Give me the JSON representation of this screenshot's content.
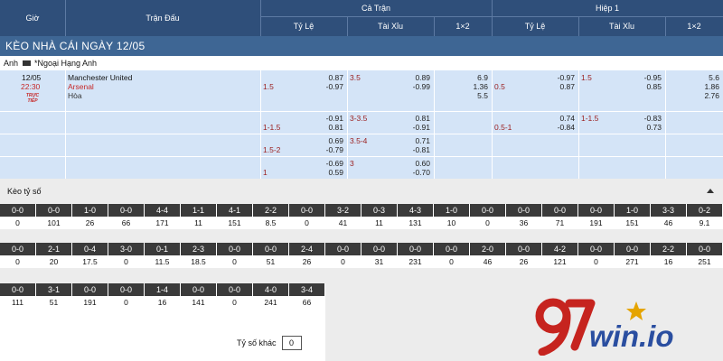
{
  "header": {
    "time": "Giờ",
    "match": "Trận Đấu",
    "full_time": "Cả Trận",
    "first_half": "Hiệp 1",
    "handicap": "Tỷ Lệ",
    "over_under": "Tài Xỉu",
    "one_x_two": "1×2"
  },
  "title": "KÈO NHÀ CÁI NGÀY 12/05",
  "league": {
    "country": "Anh",
    "name": "*Ngoại Hạng Anh"
  },
  "match": {
    "date": "12/05",
    "time": "22:30",
    "live": "TRỰC TIẾP",
    "home": "Manchester United",
    "away": "Arsenal",
    "draw": "Hòa"
  },
  "odds_rows": [
    {
      "ft_hdp_line": "1.5",
      "ft_hdp_home": "0.87",
      "ft_hdp_away": "-0.97",
      "ft_ou_line": "3.5",
      "ft_ou_over": "0.89",
      "ft_ou_under": "-0.99",
      "ft_1x2": [
        "6.9",
        "1.36",
        "5.5"
      ],
      "h1_hdp_line": "0.5",
      "h1_hdp_home": "-0.97",
      "h1_hdp_away": "0.87",
      "h1_ou_line": "1.5",
      "h1_ou_over": "-0.95",
      "h1_ou_under": "0.85",
      "h1_1x2": [
        "5.6",
        "1.86",
        "2.76"
      ]
    },
    {
      "ft_hdp_line": "1-1.5",
      "ft_hdp_home": "-0.91",
      "ft_hdp_away": "0.81",
      "ft_ou_line": "3-3.5",
      "ft_ou_over": "0.81",
      "ft_ou_under": "-0.91",
      "h1_hdp_line": "0.5-1",
      "h1_hdp_home": "0.74",
      "h1_hdp_away": "-0.84",
      "h1_ou_line": "1-1.5",
      "h1_ou_over": "-0.83",
      "h1_ou_under": "0.73"
    },
    {
      "ft_hdp_line": "1.5-2",
      "ft_hdp_home": "0.69",
      "ft_hdp_away": "-0.79",
      "ft_ou_line": "3.5-4",
      "ft_ou_over": "0.71",
      "ft_ou_under": "-0.81"
    },
    {
      "ft_hdp_line": "1",
      "ft_hdp_home": "-0.69",
      "ft_hdp_away": "0.59",
      "ft_ou_line": "3",
      "ft_ou_over": "0.60",
      "ft_ou_under": "-0.70"
    }
  ],
  "correct_score": {
    "title": "Kèo tỷ số",
    "row1": [
      {
        "s": "0-0",
        "v": "0"
      },
      {
        "s": "0-0",
        "v": "101"
      },
      {
        "s": "1-0",
        "v": "26"
      },
      {
        "s": "0-0",
        "v": "66"
      },
      {
        "s": "4-4",
        "v": "171"
      },
      {
        "s": "1-1",
        "v": "11"
      },
      {
        "s": "4-1",
        "v": "151"
      },
      {
        "s": "2-2",
        "v": "8.5"
      },
      {
        "s": "0-0",
        "v": "0"
      },
      {
        "s": "3-2",
        "v": "41"
      },
      {
        "s": "0-3",
        "v": "11"
      },
      {
        "s": "4-3",
        "v": "131"
      },
      {
        "s": "1-0",
        "v": "10"
      },
      {
        "s": "0-0",
        "v": "0"
      },
      {
        "s": "0-0",
        "v": "36"
      },
      {
        "s": "0-0",
        "v": "71"
      },
      {
        "s": "0-0",
        "v": "191"
      },
      {
        "s": "1-0",
        "v": "151"
      },
      {
        "s": "3-3",
        "v": "46"
      },
      {
        "s": "0-2",
        "v": "9.1"
      }
    ],
    "row2": [
      {
        "s": "0-0",
        "v": "0"
      },
      {
        "s": "2-1",
        "v": "20"
      },
      {
        "s": "0-4",
        "v": "17.5"
      },
      {
        "s": "3-0",
        "v": "0"
      },
      {
        "s": "0-1",
        "v": "11.5"
      },
      {
        "s": "2-3",
        "v": "18.5"
      },
      {
        "s": "0-0",
        "v": "0"
      },
      {
        "s": "0-0",
        "v": "51"
      },
      {
        "s": "2-4",
        "v": "26"
      },
      {
        "s": "0-0",
        "v": "0"
      },
      {
        "s": "0-0",
        "v": "31"
      },
      {
        "s": "0-0",
        "v": "231"
      },
      {
        "s": "0-0",
        "v": "0"
      },
      {
        "s": "2-0",
        "v": "46"
      },
      {
        "s": "0-0",
        "v": "26"
      },
      {
        "s": "4-2",
        "v": "121"
      },
      {
        "s": "0-0",
        "v": "0"
      },
      {
        "s": "0-0",
        "v": "271"
      },
      {
        "s": "2-2",
        "v": "16"
      },
      {
        "s": "0-0",
        "v": "251"
      }
    ],
    "row3": [
      {
        "s": "0-0",
        "v": "111"
      },
      {
        "s": "3-1",
        "v": "51"
      },
      {
        "s": "0-0",
        "v": "191"
      },
      {
        "s": "0-0",
        "v": "0"
      },
      {
        "s": "1-4",
        "v": "16"
      },
      {
        "s": "0-0",
        "v": "141"
      },
      {
        "s": "0-0",
        "v": "0"
      },
      {
        "s": "4-0",
        "v": "241"
      },
      {
        "s": "3-4",
        "v": "66"
      }
    ],
    "other_label": "Tỷ số khác",
    "other_value": "0"
  },
  "logo": {
    "digits": "97",
    "text": "win.io"
  },
  "colors": {
    "header": "#2f4f7a",
    "title_bar": "#3e6694",
    "row_bg": "#d4e4f7",
    "accent_red": "#c62828",
    "logo_red": "#c6241f",
    "logo_blue": "#2a4ea0",
    "logo_gold": "#e5a400"
  }
}
